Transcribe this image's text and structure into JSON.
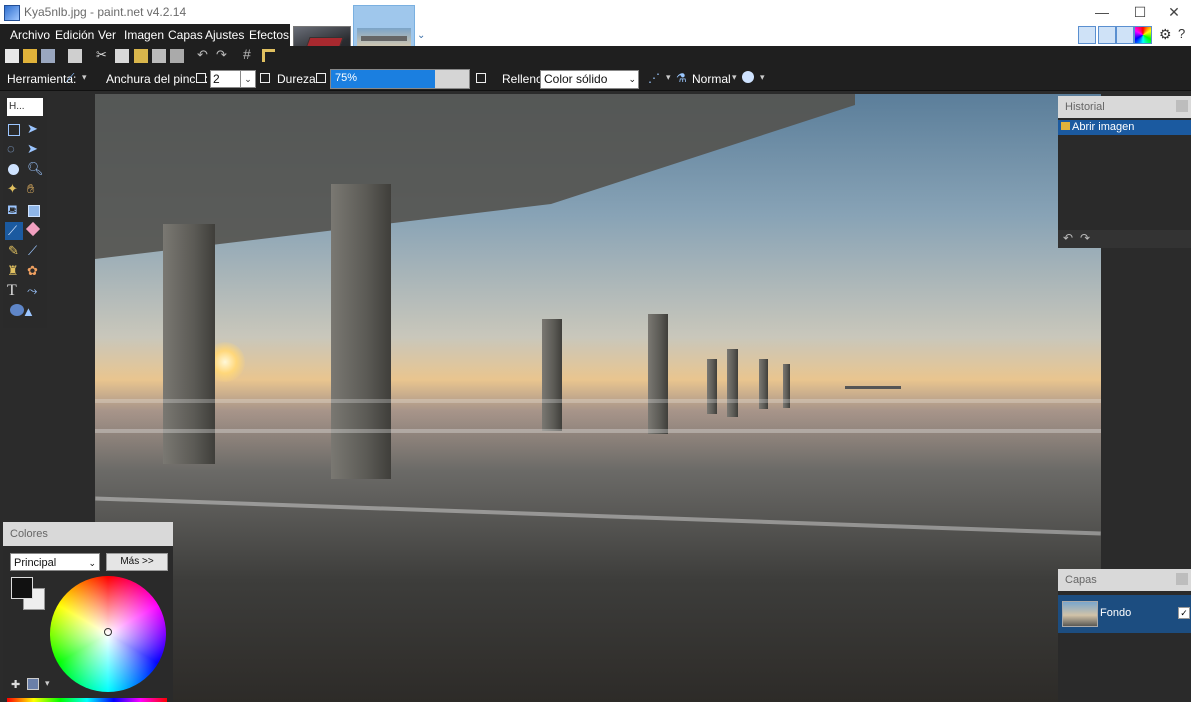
{
  "window": {
    "title": "Kya5nlb.jpg - paint.net v4.2.14",
    "controls": [
      "—",
      "☐",
      "✕"
    ]
  },
  "menu": {
    "items": [
      "Archivo",
      "Edición",
      "Ver",
      "Imagen",
      "Capas",
      "Ajustes",
      "Efectos"
    ]
  },
  "image_tabs": [
    {
      "name": "laptop-thumbnail"
    },
    {
      "name": "pier-thumbnail",
      "active": true
    }
  ],
  "options": {
    "tool_label": "Herramienta:",
    "brush_width_label": "Anchura del pincel:",
    "brush_width_value": "2",
    "hardness_label": "Dureza:",
    "hardness_value": "75%",
    "hardness_percent": 75,
    "fill_label": "Relleno:",
    "fill_value": "Color sólido",
    "blend_mode": "Normal"
  },
  "tools_panel": {
    "header": "H..."
  },
  "history_panel": {
    "title": "Historial",
    "items": [
      "Abrir imagen"
    ]
  },
  "layers_panel": {
    "title": "Capas",
    "layers": [
      {
        "name": "Fondo",
        "visible": true
      }
    ]
  },
  "colors_panel": {
    "title": "Colores",
    "palette": "Principal",
    "more_button": "Más >>",
    "primary_color": "#111111",
    "secondary_color": "#eeeeee"
  },
  "colors": {
    "chrome_dark": "#1f1f1f",
    "accent": "#1b7fe0",
    "selection": "#1b5aa0"
  }
}
